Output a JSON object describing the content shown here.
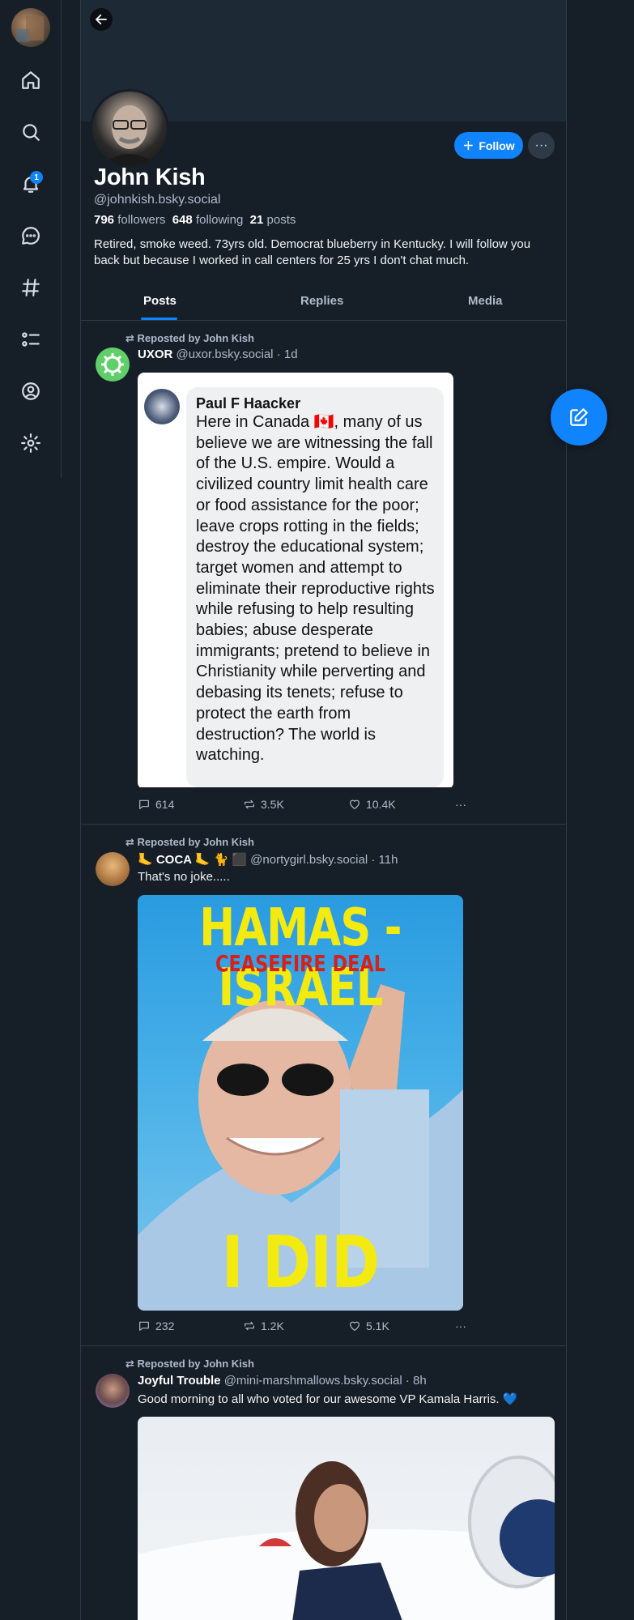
{
  "nav": {
    "notification_count": "1",
    "items": [
      "home",
      "search",
      "notifications",
      "chat",
      "feeds",
      "lists",
      "profile",
      "settings"
    ]
  },
  "profile": {
    "display_name": "John Kish",
    "handle": "@johnkish.bsky.social",
    "followers_count": "796",
    "followers_label": "followers",
    "following_count": "648",
    "following_label": "following",
    "posts_count": "21",
    "posts_label": "posts",
    "bio": "Retired, smoke weed. 73yrs old. Democrat blueberry in Kentucky. I will follow you back but because I worked in call centers for 25 yrs  I don't chat much.",
    "follow_label": "Follow"
  },
  "tabs": [
    "Posts",
    "Replies",
    "Media"
  ],
  "posts": [
    {
      "repost_label": "Reposted by John Kish",
      "author_name": "UXOR",
      "author_handle": "@uxor.bsky.social",
      "time": "· 1d",
      "text": "",
      "image": {
        "name": "Paul F Haacker",
        "text": "Here in Canada 🇨🇦, many of us believe we are witnessing the fall of the U.S. empire.   Would a civilized country limit health care or food assistance for the poor; leave crops rotting in the fields;  destroy the educational system; target women and attempt to eliminate their reproductive rights while refusing to help resulting babies;  abuse desperate immigrants; pretend to believe in Christianity while perverting and debasing its tenets; refuse to protect the earth from destruction?  The world is watching."
      },
      "replies": "614",
      "reposts": "3.5K",
      "likes": "10.4K"
    },
    {
      "repost_label": "Reposted by John Kish",
      "author_name": "🦶 COCA 🦶 🐈 ⬛",
      "author_handle": "@nortygirl.bsky.social",
      "time": "· 11h",
      "text": "That's no joke.....",
      "image": {
        "headline": "HAMAS - ISRAEL",
        "subheadline": "CEASEFIRE DEAL",
        "caption": "I DID THAT"
      },
      "replies": "232",
      "reposts": "1.2K",
      "likes": "5.1K"
    },
    {
      "repost_label": "Reposted by John Kish",
      "author_name": "Joyful Trouble",
      "author_handle": "@mini-marshmallows.bsky.social",
      "time": "· 8h",
      "text": "Good morning to all who voted for our awesome VP Kamala Harris. 💙"
    }
  ],
  "colors": {
    "background": "#161e27",
    "accent": "#1083fe",
    "muted_text": "#aebbc9",
    "border": "#2e3a48"
  }
}
